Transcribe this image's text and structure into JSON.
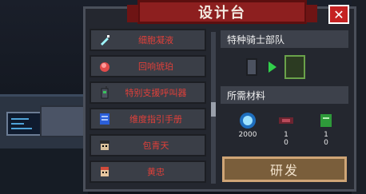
{
  "title": "设计台",
  "close_label": "✕",
  "list_items": [
    {
      "label": "细胞凝液",
      "icon": "crystal-syringe-icon"
    },
    {
      "label": "回响琥珀",
      "icon": "amber-gem-icon"
    },
    {
      "label": "特别支援呼叫器",
      "icon": "walkie-talkie-icon"
    },
    {
      "label": "维度指引手册",
      "icon": "manual-book-icon"
    },
    {
      "label": "包青天",
      "icon": "mask-character-icon"
    },
    {
      "label": "黄忠",
      "icon": "warrior-character-icon"
    }
  ],
  "product_section": {
    "title": "特种骑士部队"
  },
  "materials_section": {
    "title": "所需材料"
  },
  "materials": [
    {
      "name": "energy-crystal-icon",
      "amount": "2000",
      "have": ""
    },
    {
      "name": "gauntlet-icon",
      "amount": "1",
      "have": "0"
    },
    {
      "name": "green-book-icon",
      "amount": "1",
      "have": "0"
    }
  ],
  "craft_button": "研发",
  "colors": {
    "banner": "#8d1f1f",
    "item_text": "#e0403a",
    "craft_button": "#7a5e3b",
    "close_button": "#c52222"
  }
}
